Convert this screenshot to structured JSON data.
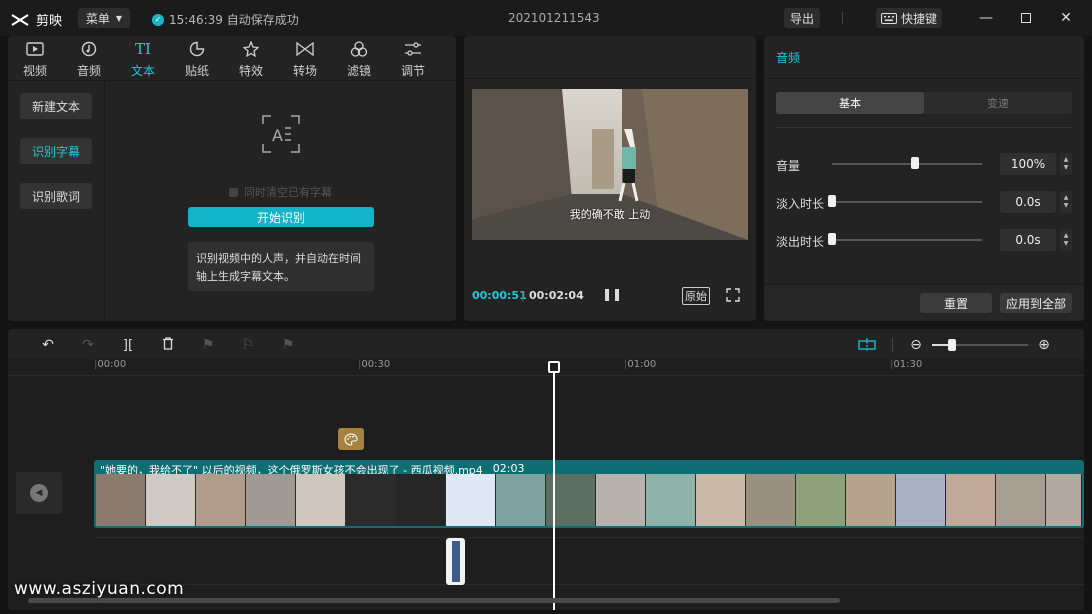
{
  "titlebar": {
    "app_name": "剪映",
    "menu_label": "菜单",
    "save_status": "15:46:39 自动保存成功",
    "project_name": "202101211543",
    "export_label": "导出",
    "shortcut_label": "快捷键"
  },
  "media_tabs": [
    {
      "label": "视频",
      "icon": "video-icon"
    },
    {
      "label": "音频",
      "icon": "audio-icon"
    },
    {
      "label": "文本",
      "icon": "text-icon"
    },
    {
      "label": "贴纸",
      "icon": "sticker-icon"
    },
    {
      "label": "特效",
      "icon": "effects-icon"
    },
    {
      "label": "转场",
      "icon": "transition-icon"
    },
    {
      "label": "滤镜",
      "icon": "filter-icon"
    },
    {
      "label": "调节",
      "icon": "adjust-icon"
    }
  ],
  "text_subnav": {
    "new_text": "新建文本",
    "recognize_subtitle": "识别字幕",
    "recognize_lyrics": "识别歌词"
  },
  "recognize": {
    "clear_checkbox_label": "同时清空已有字幕",
    "start_button": "开始识别",
    "info": "识别视频中的人声，并自动在时间轴上生成字幕文本。"
  },
  "preview": {
    "subtitle": "我的确不敢 上动",
    "current_time": "00:00:51",
    "total_time": "00:02:04",
    "ratio_label": "原始"
  },
  "audio_panel": {
    "title": "音频",
    "tab_basic": "基本",
    "tab_speed": "变速",
    "volume_label": "音量",
    "volume_value": "100%",
    "volume_level": 0.55,
    "fade_in_label": "淡入时长",
    "fade_in_value": "0.0s",
    "fade_out_label": "淡出时长",
    "fade_out_value": "0.0s",
    "reset_label": "重置",
    "apply_all_label": "应用到全部"
  },
  "timeline": {
    "ticks": [
      "00:00",
      "00:30",
      "01:00",
      "01:30"
    ],
    "clip_title": "\"她要的，我给不了\" 以后的视频，这个俄罗斯女孩不会出现了 - 西瓜视频.mp4",
    "clip_duration": "02:03"
  },
  "watermark": "www.asziyuan.com",
  "colors": {
    "accent": "#1ec8d8",
    "clip_track": "#0e6e73",
    "background": "#141414",
    "panel": "#232323"
  }
}
